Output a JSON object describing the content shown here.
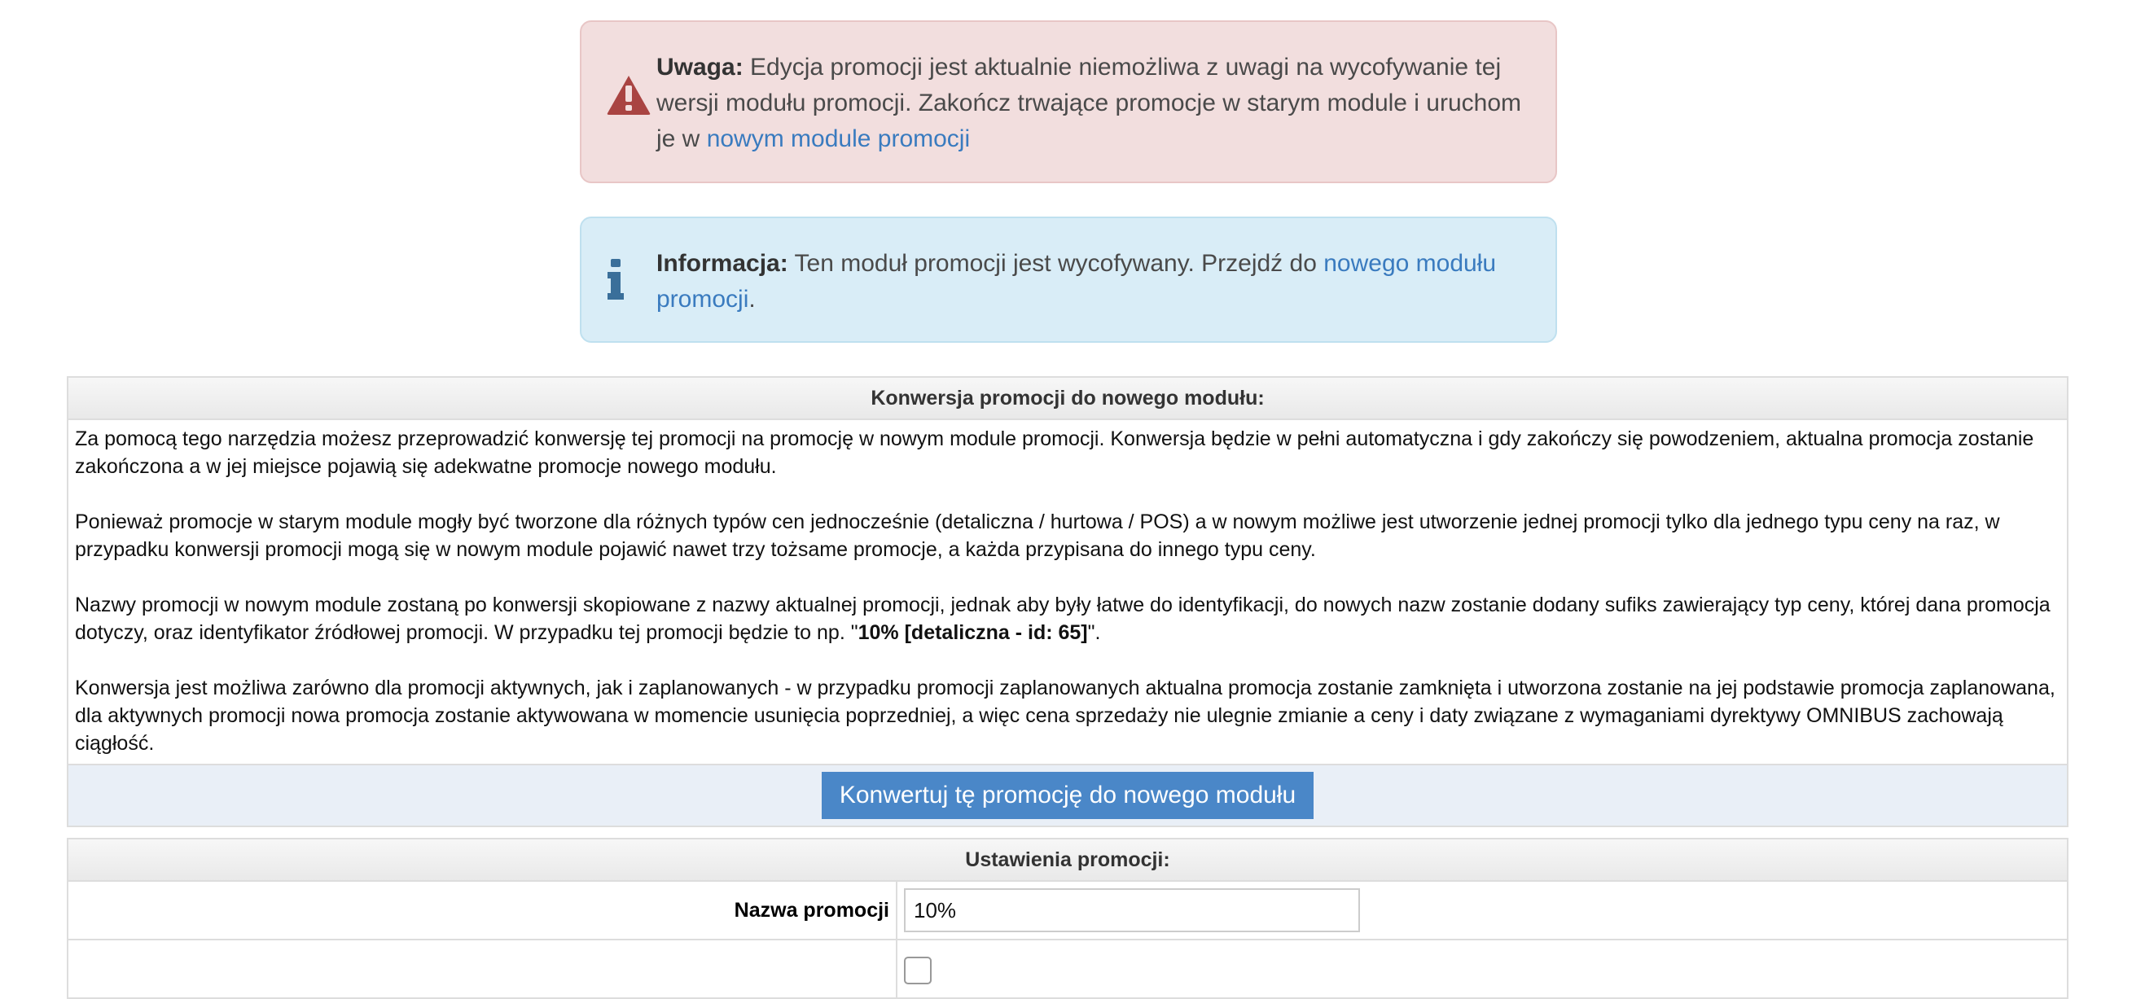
{
  "warning": {
    "prefix": "Uwaga:",
    "text": " Edycja promocji jest aktualnie niemożliwa z uwagi na wycofywanie tej wersji modułu promocji. Zakończ trwające promocje w starym module i uruchom je w ",
    "link": "nowym module promocji"
  },
  "info": {
    "prefix": "Informacja:",
    "text": " Ten moduł promocji jest wycofywany. Przejdź do ",
    "link": "nowego modułu promocji",
    "suffix": "."
  },
  "conversion": {
    "title": "Konwersja promocji do nowego modułu:",
    "p1": "Za pomocą tego narzędzia możesz przeprowadzić konwersję tej promocji na promocję w nowym module promocji. Konwersja będzie w pełni automatyczna i gdy zakończy się powodzeniem, aktualna promocja zostanie zakończona a w jej miejsce pojawią się adekwatne promocje nowego modułu.",
    "p2": "Ponieważ promocje w starym module mogły być tworzone dla różnych typów cen jednocześnie (detaliczna / hurtowa / POS) a w nowym możliwe jest utworzenie jednej promocji tylko dla jednego typu ceny na raz, w przypadku konwersji promocji mogą się w nowym module pojawić nawet trzy tożsame promocje, a każda przypisana do innego typu ceny.",
    "p3_start": "Nazwy promocji w nowym module zostaną po konwersji skopiowane z nazwy aktualnej promocji, jednak aby były łatwe do identyfikacji, do nowych nazw zostanie dodany sufiks zawierający typ ceny, której dana promocja dotyczy, oraz identyfikator źródłowej promocji. W przypadku tej promocji będzie to np. \"",
    "p3_example": "10% [detaliczna - id: 65]",
    "p3_end": "\".",
    "p4": "Konwersja jest możliwa zarówno dla promocji aktywnych, jak i zaplanowanych - w przypadku promocji zaplanowanych aktualna promocja zostanie zamknięta i utworzona zostanie na jej podstawie promocja zaplanowana, dla aktywnych promocji nowa promocja zostanie aktywowana w momencie usunięcia poprzedniej, a więc cena sprzedaży nie ulegnie zmianie a ceny i daty związane z wymaganiami dyrektywy OMNIBUS zachowają ciągłość.",
    "button": "Konwertuj tę promocję do nowego modułu"
  },
  "settings": {
    "title": "Ustawienia promocji:",
    "name_label": "Nazwa promocji",
    "name_value": "10%"
  },
  "colors": {
    "danger_bg": "#f2dede",
    "info_bg": "#d9edf7",
    "link": "#3a7bbf",
    "button": "#4a87c8"
  }
}
